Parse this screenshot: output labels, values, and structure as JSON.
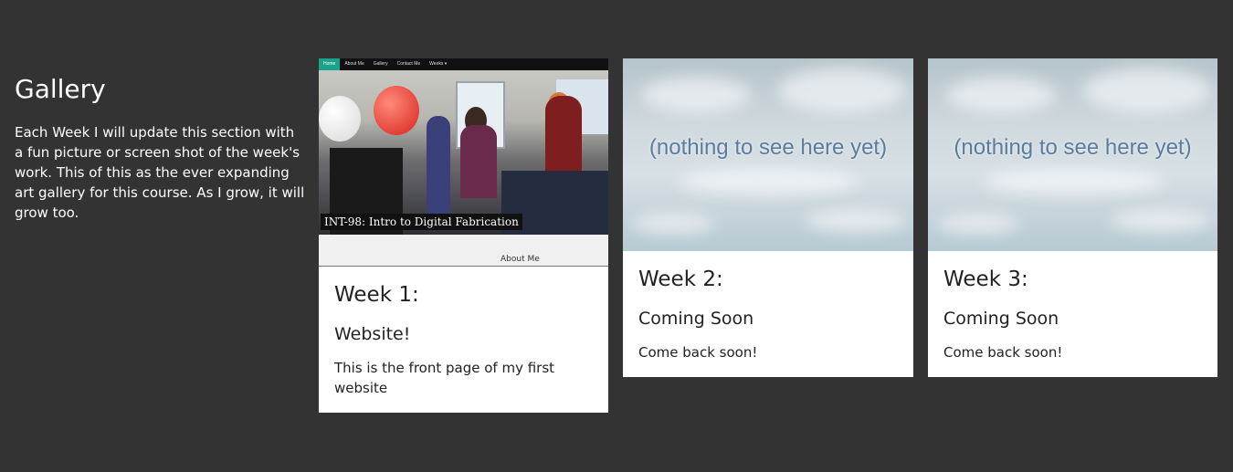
{
  "intro": {
    "title": "Gallery",
    "text": "Each Week I will update this section with a fun picture or screen shot of the week's work. This of this as the ever expanding art gallery for this course. As I grow, it will grow too."
  },
  "cards": [
    {
      "title": "Week 1:",
      "subtitle": "Website!",
      "text": "This is the front page of my first website",
      "thumb": {
        "nav": [
          "Home",
          "About Me",
          "Gallery",
          "Contact Me",
          "Weeks ▾"
        ],
        "caption": "INT-98: Intro to Digital Fabrication",
        "below_link": "About Me"
      }
    },
    {
      "title": "Week 2:",
      "subtitle": "Coming Soon",
      "text": "Come back soon!",
      "thumb": {
        "label": "(nothing to see here yet)"
      }
    },
    {
      "title": "Week 3:",
      "subtitle": "Coming Soon",
      "text": "Come back soon!",
      "thumb": {
        "label": "(nothing to see here yet)"
      }
    }
  ],
  "colors": {
    "page_background": "#333333",
    "card_background": "#ffffff",
    "nav_active": "#1aa38a",
    "placeholder_text": "#5b7c9e"
  }
}
